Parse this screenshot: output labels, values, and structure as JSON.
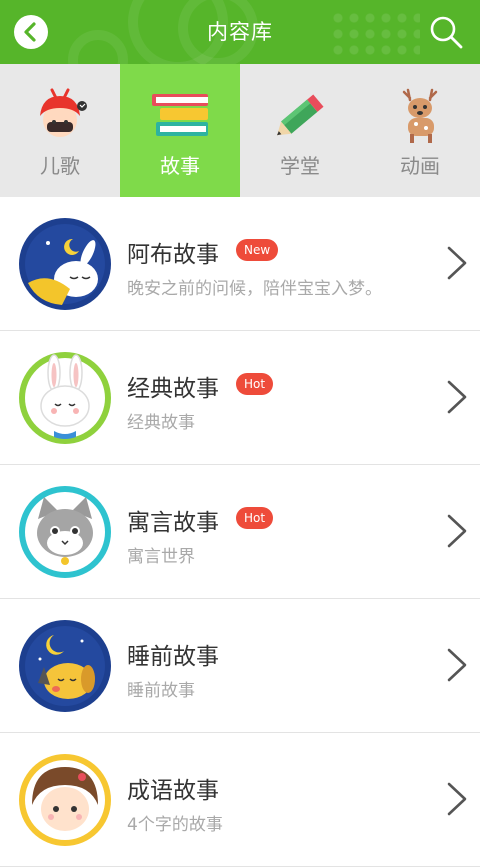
{
  "header": {
    "title": "内容库",
    "color": "#56b52a"
  },
  "tabs": [
    {
      "label": "儿歌",
      "icon": "red-hat-girl-icon",
      "active": false
    },
    {
      "label": "故事",
      "icon": "books-stack-icon",
      "active": true
    },
    {
      "label": "学堂",
      "icon": "pencil-icon",
      "active": false
    },
    {
      "label": "动画",
      "icon": "deer-icon",
      "active": false
    }
  ],
  "items": [
    {
      "title": "阿布故事",
      "badge": "New",
      "subtitle": "晚安之前的问候，陪伴宝宝入梦。",
      "avatar": "sleeping-bunny-moon-icon"
    },
    {
      "title": "经典故事",
      "badge": "Hot",
      "subtitle": "经典故事",
      "avatar": "white-bunny-icon"
    },
    {
      "title": "寓言故事",
      "badge": "Hot",
      "subtitle": "寓言世界",
      "avatar": "grey-cat-icon"
    },
    {
      "title": "睡前故事",
      "badge": "",
      "subtitle": "睡前故事",
      "avatar": "sleeping-dog-moon-icon"
    },
    {
      "title": "成语故事",
      "badge": "",
      "subtitle": "4个字的故事",
      "avatar": "girl-face-icon"
    }
  ],
  "colors": {
    "accent": "#56b52a",
    "active_tab": "#7fda4a",
    "badge": "#ee4b3a"
  }
}
